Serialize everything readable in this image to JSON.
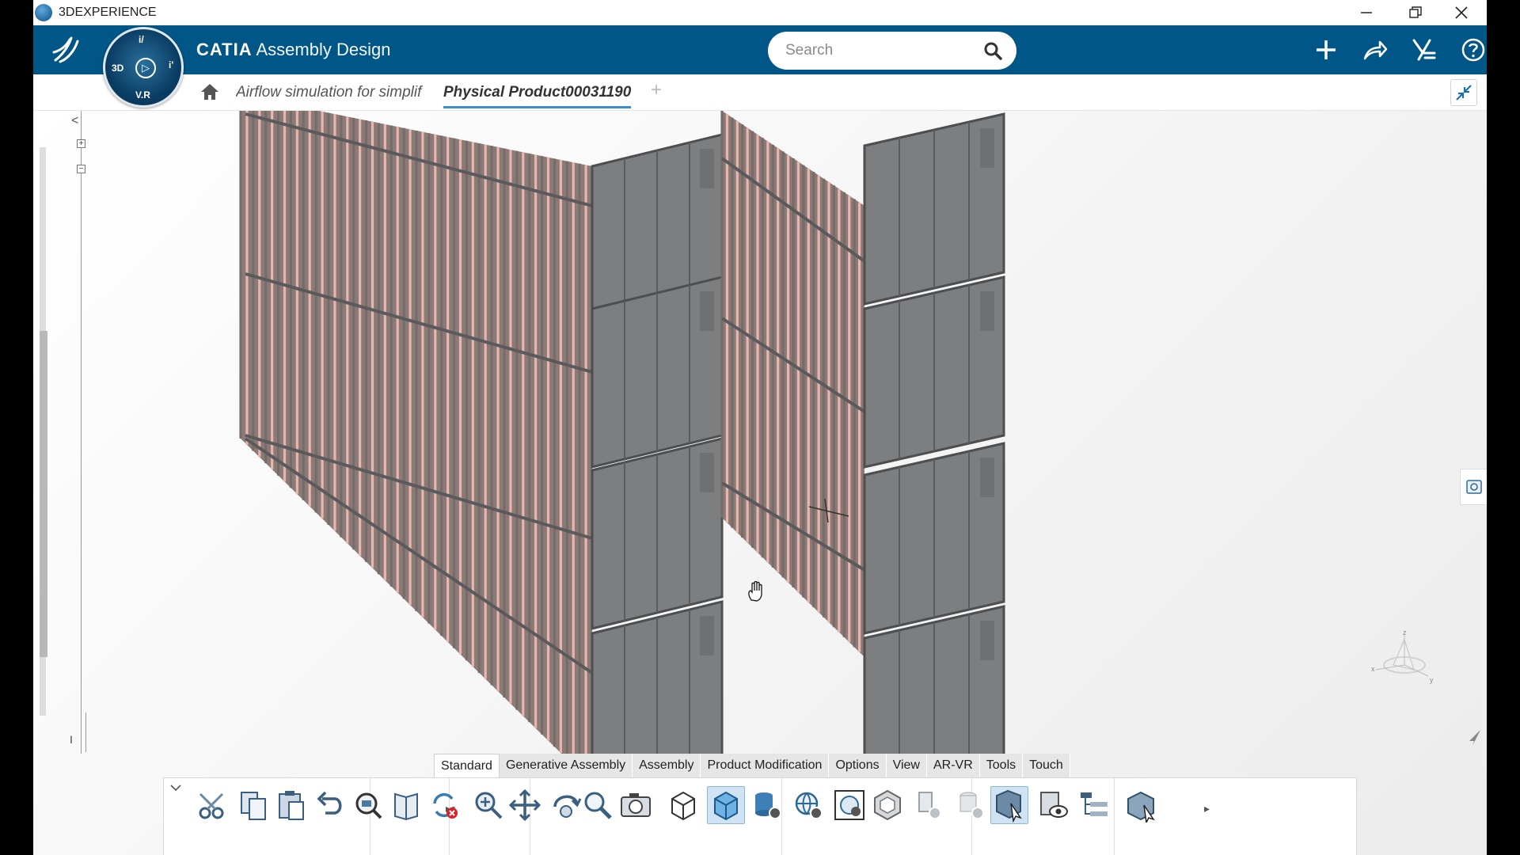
{
  "os": {
    "title": "3DEXPERIENCE"
  },
  "header": {
    "brand_bold": "CATIA",
    "brand_app": "Assembly Design",
    "compass": {
      "north": "i/",
      "west": "3D",
      "east": "i'",
      "south": "V.R"
    },
    "search": {
      "placeholder": "Search"
    }
  },
  "tabs": {
    "previous": "Airflow simulation for simplif",
    "active": "Physical Product00031190",
    "add": "+"
  },
  "tree": {
    "collapse": "<",
    "plus": "+",
    "minus": "−",
    "caret": "I"
  },
  "action_tabs": [
    "Standard",
    "Generative Assembly",
    "Assembly",
    "Product Modification",
    "Options",
    "View",
    "AR-VR",
    "Tools",
    "Touch"
  ],
  "active_action_tab": "Standard",
  "toolbar_icons": [
    "cut-icon",
    "copy-icon",
    "paste-icon",
    "undo-icon",
    "search-zoom-icon",
    "book-icon",
    "update-icon",
    "zoom-icon",
    "pan-icon",
    "rotate-icon",
    "magnifier-icon",
    "capture-icon",
    "wireframe-icon",
    "shaded-icon",
    "db-gear-icon",
    "globe-gear-icon",
    "spec-globe-icon",
    "hex-icon",
    "pipe-gear-icon",
    "cylinder-gear-icon",
    "select-box-icon",
    "visibility-icon",
    "tree-icon",
    "cube-select-icon"
  ],
  "axis": {
    "x": "x",
    "y": "y",
    "z": "z"
  },
  "colors": {
    "header_blue": "#005686",
    "container_grey": "#7d7e80",
    "rib_pink": "#e8b6ab",
    "active_tab_underline": "#3a8fd1"
  }
}
